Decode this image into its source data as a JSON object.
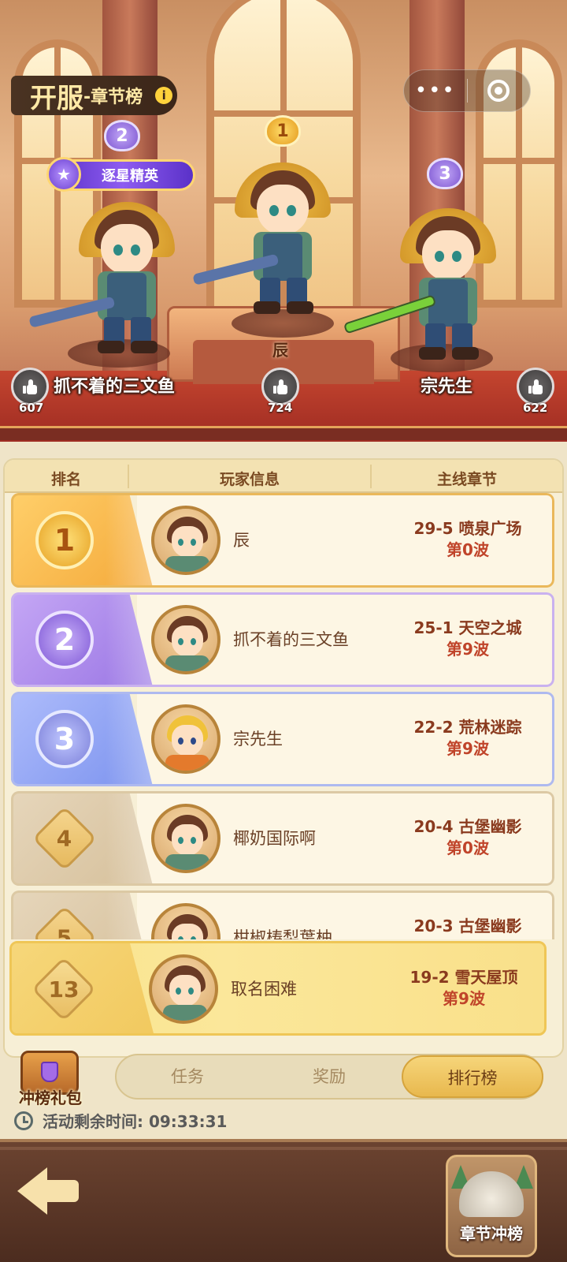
{
  "header": {
    "title_main": "开服",
    "title_sub": "-章节榜",
    "info_icon": "info-icon"
  },
  "capsule": {
    "more_icon": "more-dots-icon",
    "close_icon": "close-ring-icon"
  },
  "podium": {
    "first": {
      "rank": "1",
      "name": "辰",
      "likes": "724"
    },
    "second": {
      "rank": "2",
      "name": "抓不着的三文鱼",
      "likes": "607",
      "title_badge": "逐星精英"
    },
    "third": {
      "rank": "3",
      "name": "宗先生",
      "likes": "622"
    }
  },
  "table": {
    "headers": [
      "排名",
      "玩家信息",
      "主线章节"
    ],
    "rows": [
      {
        "rank": "1",
        "name": "辰",
        "chapter": "29-5 喷泉广场",
        "wave": "第0波",
        "avatar": "brown"
      },
      {
        "rank": "2",
        "name": "抓不着的三文鱼",
        "chapter": "25-1 天空之城",
        "wave": "第9波",
        "avatar": "brown"
      },
      {
        "rank": "3",
        "name": "宗先生",
        "chapter": "22-2 荒林迷踪",
        "wave": "第9波",
        "avatar": "blond"
      },
      {
        "rank": "4",
        "name": "椰奶国际啊",
        "chapter": "20-4 古堡幽影",
        "wave": "第0波",
        "avatar": "brown"
      },
      {
        "rank": "5",
        "name": "柑椒梼梨葉柚",
        "chapter": "20-3 古堡幽影",
        "wave": "",
        "avatar": "brown"
      }
    ]
  },
  "my_rank": {
    "rank": "13",
    "name": "取名困难",
    "chapter": "19-2 雪天屋顶",
    "wave": "第9波"
  },
  "gift": {
    "label": "冲榜礼包"
  },
  "tabs": [
    {
      "label": "任务",
      "active": false
    },
    {
      "label": "奖励",
      "active": false
    },
    {
      "label": "排行榜",
      "active": true
    }
  ],
  "timer": {
    "text": "活动剩余时间: 09:33:31"
  },
  "bottom": {
    "chapter_button_label": "章节冲榜"
  },
  "colors": {
    "gold": "#e8b84e",
    "purple": "#8e5cf0",
    "blue": "#6f8ef0",
    "brown": "#4c2c1f"
  }
}
